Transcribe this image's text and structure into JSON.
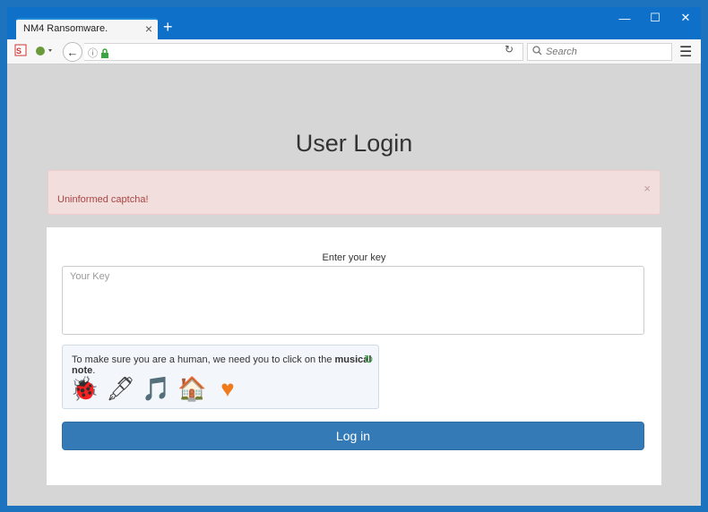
{
  "browser": {
    "tab_title": "NM4 Ransomware.",
    "tab_close": "×",
    "new_tab": "+",
    "window_controls": {
      "minimize": "—",
      "maximize": "☐",
      "close": "✕"
    },
    "nav": {
      "back": "←",
      "info": "ⓘ",
      "lock": "🔒",
      "reload": "↻",
      "url": "",
      "search_placeholder": "Search",
      "menu": "☰"
    }
  },
  "page": {
    "title": "User Login",
    "alert": {
      "message": "Uninformed captcha!",
      "close": "×"
    },
    "form": {
      "key_label": "Enter your key",
      "key_placeholder": "Your Key",
      "key_value": ""
    },
    "captcha": {
      "instruction_prefix": "To make sure you are a human, we need you to click on the ",
      "target": "musical note",
      "instruction_suffix": ".",
      "refresh": "↻",
      "icons": [
        {
          "name": "bug",
          "glyph": "🐞",
          "color": "#d9531e"
        },
        {
          "name": "pen",
          "glyph": "🖋",
          "color": "#444444"
        },
        {
          "name": "musical-note",
          "glyph": "🎵",
          "color": "#2b6fb0"
        },
        {
          "name": "house",
          "glyph": "🏠",
          "color": "#3a8ed8"
        },
        {
          "name": "heart",
          "glyph": "♥",
          "color": "#f07a1e"
        }
      ]
    },
    "login_button": "Log in"
  },
  "colors": {
    "chrome_blue": "#0f70c9",
    "page_bg": "#d6d6d6",
    "alert_bg": "#f3dede",
    "alert_text": "#a94442",
    "primary_button": "#337ab7",
    "refresh_green": "#3aa541"
  }
}
